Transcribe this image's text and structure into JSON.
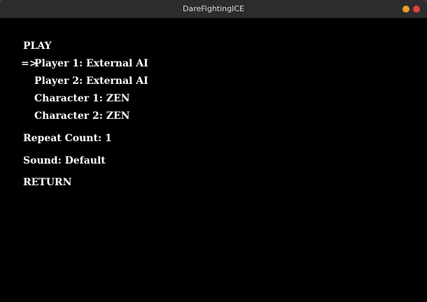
{
  "window": {
    "title": "DareFightingICE",
    "controls": {
      "minimize_color": "#e8a02a",
      "close_color": "#e0433a"
    }
  },
  "menu": {
    "cursor": "=>",
    "items": [
      {
        "label": "PLAY",
        "selected": false
      },
      {
        "label": "Player 1: External AI",
        "selected": true
      },
      {
        "label": "Player 2: External AI",
        "selected": false
      },
      {
        "label": "Character 1: ZEN",
        "selected": false
      },
      {
        "label": "Character 2: ZEN",
        "selected": false
      },
      {
        "label": "Repeat Count: 1",
        "selected": false
      },
      {
        "label": "Sound: Default",
        "selected": false
      },
      {
        "label": "RETURN",
        "selected": false
      }
    ]
  }
}
